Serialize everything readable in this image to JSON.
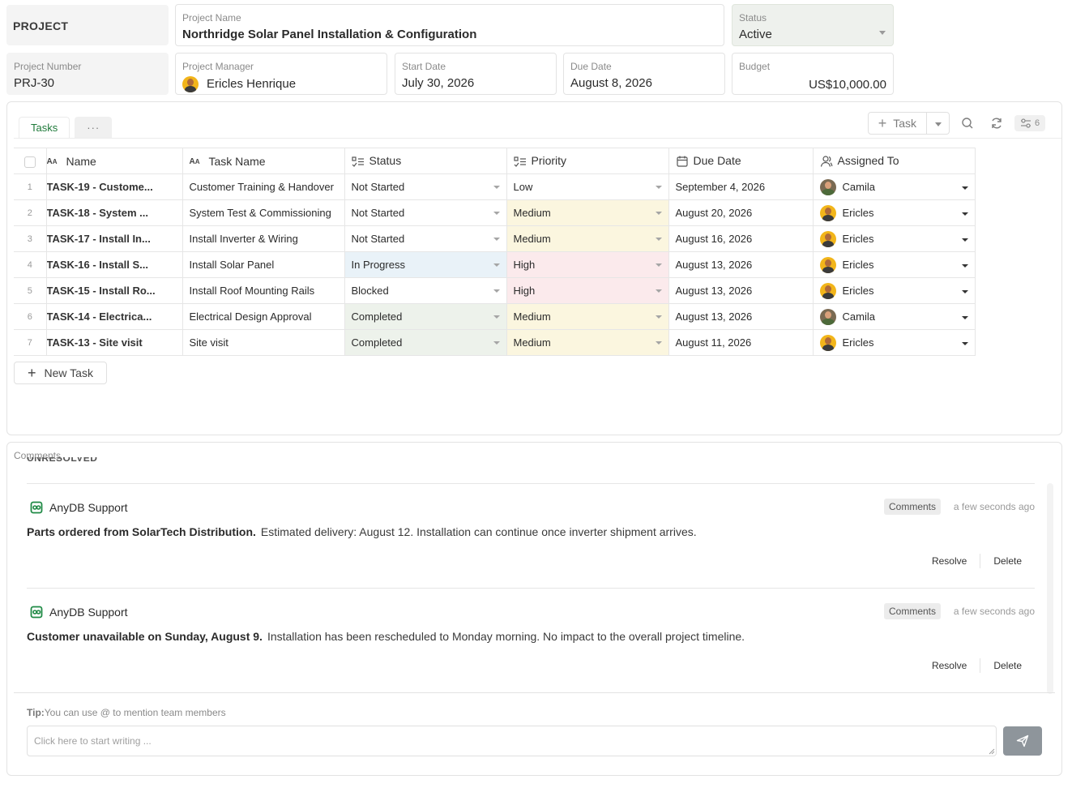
{
  "project": {
    "tag": "PROJECT",
    "name_label": "Project Name",
    "name": "Northridge Solar Panel Installation & Configuration",
    "status_label": "Status",
    "status": "Active",
    "number_label": "Project Number",
    "number": "PRJ-30",
    "manager_label": "Project Manager",
    "manager": "Ericles Henrique",
    "start_label": "Start Date",
    "start": "July 30, 2026",
    "due_label": "Due Date",
    "due": "August 8, 2026",
    "budget_label": "Budget",
    "budget": "US$10,000.00"
  },
  "tasks_panel": {
    "tab": "Tasks",
    "more_tab": "···",
    "add_task": "Task",
    "filter_count": "6",
    "new_task": "New Task",
    "columns": {
      "name": "Name",
      "task_name": "Task Name",
      "status": "Status",
      "priority": "Priority",
      "due_date": "Due Date",
      "assigned_to": "Assigned To"
    },
    "rows": [
      {
        "num": "1",
        "name": "TASK-19 - Custome...",
        "task_name": "Customer Training & Handover",
        "status": "Not Started",
        "priority": "Low",
        "due": "September 4, 2026",
        "assignee": "Camila"
      },
      {
        "num": "2",
        "name": "TASK-18 - System ...",
        "task_name": "System Test & Commissioning",
        "status": "Not Started",
        "priority": "Medium",
        "due": "August 20, 2026",
        "assignee": "Ericles"
      },
      {
        "num": "3",
        "name": "TASK-17 - Install In...",
        "task_name": "Install Inverter & Wiring",
        "status": "Not Started",
        "priority": "Medium",
        "due": "August 16, 2026",
        "assignee": "Ericles"
      },
      {
        "num": "4",
        "name": "TASK-16 - Install S...",
        "task_name": "Install Solar Panel",
        "status": "In Progress",
        "priority": "High",
        "due": "August 13, 2026",
        "assignee": "Ericles"
      },
      {
        "num": "5",
        "name": "TASK-15 - Install Ro...",
        "task_name": "Install Roof Mounting Rails",
        "status": "Blocked",
        "priority": "High",
        "due": "August 13, 2026",
        "assignee": "Ericles"
      },
      {
        "num": "6",
        "name": "TASK-14 - Electrica...",
        "task_name": "Electrical Design Approval",
        "status": "Completed",
        "priority": "Medium",
        "due": "August 13, 2026",
        "assignee": "Camila"
      },
      {
        "num": "7",
        "name": "TASK-13 - Site visit",
        "task_name": "Site visit",
        "status": "Completed",
        "priority": "Medium",
        "due": "August 11, 2026",
        "assignee": "Ericles"
      }
    ]
  },
  "comments_panel": {
    "title": "Comments",
    "section": "UNRESOLVED",
    "comments": [
      {
        "author": "AnyDB Support",
        "badge": "Comments",
        "time": "a few seconds ago",
        "bold": "Parts ordered from SolarTech Distribution.",
        "text": "Estimated delivery: August 12. Installation can continue once inverter shipment arrives.",
        "resolve": "Resolve",
        "delete": "Delete"
      },
      {
        "author": "AnyDB Support",
        "badge": "Comments",
        "time": "a few seconds ago",
        "bold": "Customer unavailable on Sunday, August 9.",
        "text": "Installation has been rescheduled to Monday morning. No impact to the overall project timeline.",
        "resolve": "Resolve",
        "delete": "Delete"
      }
    ],
    "tip_label": "Tip:",
    "tip_text": "You can use @ to mention team members",
    "input_placeholder": "Click here to start writing ..."
  },
  "colors": {
    "accent_green": "#1f7a3a",
    "status_in_progress": "#e9f2f8",
    "status_completed": "#edf2eb",
    "priority_medium": "#fbf6df",
    "priority_high": "#fbeaec",
    "send_button": "#8e959b"
  },
  "icons": [
    "text-type-icon",
    "checklist-icon",
    "calendar-icon",
    "user-icon",
    "search-icon",
    "refresh-icon",
    "filter-icon",
    "plus-icon",
    "send-icon",
    "anydb-logo-icon",
    "chevron-down-icon"
  ]
}
